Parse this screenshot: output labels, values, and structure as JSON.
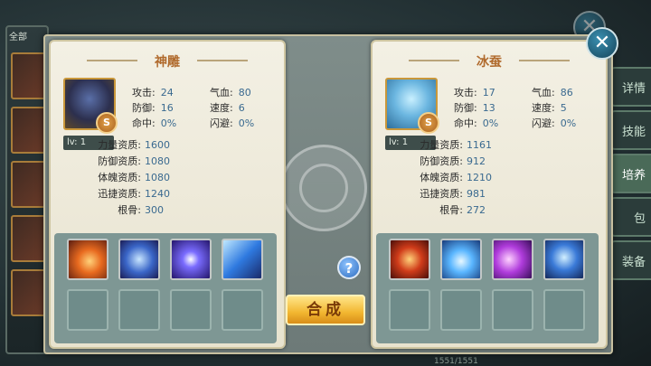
{
  "background": {
    "left_tab_label": "全部",
    "right_tabs": [
      "详情",
      "技能",
      "培养",
      "包",
      "装备"
    ],
    "footer_text": "1551/1551"
  },
  "left_pet": {
    "name": "神雕",
    "icon": "eagle-portrait",
    "rank_badge": "S",
    "level": "lv: 1",
    "stats": [
      {
        "label": "攻击:",
        "value": "24"
      },
      {
        "label": "气血:",
        "value": "80"
      },
      {
        "label": "防御:",
        "value": "16"
      },
      {
        "label": "速度:",
        "value": "6"
      },
      {
        "label": "命中:",
        "value": "0%"
      },
      {
        "label": "闪避:",
        "value": "0%"
      }
    ],
    "aptitudes": [
      {
        "label": "力量资质:",
        "value": "1600"
      },
      {
        "label": "防御资质:",
        "value": "1080"
      },
      {
        "label": "体魄资质:",
        "value": "1080"
      },
      {
        "label": "迅捷资质:",
        "value": "1240"
      },
      {
        "label": "根骨:",
        "value": "300"
      }
    ],
    "skills": [
      "fire-phoenix-skill-icon",
      "claw-slash-skill-icon",
      "thunder-orb-skill-icon",
      "lightning-z-skill-icon"
    ]
  },
  "right_pet": {
    "name": "冰蚕",
    "icon": "ice-silkworm-portrait",
    "rank_badge": "S",
    "level": "lv: 1",
    "stats": [
      {
        "label": "攻击:",
        "value": "17"
      },
      {
        "label": "气血:",
        "value": "86"
      },
      {
        "label": "防御:",
        "value": "13"
      },
      {
        "label": "速度:",
        "value": "5"
      },
      {
        "label": "命中:",
        "value": "0%"
      },
      {
        "label": "闪避:",
        "value": "0%"
      }
    ],
    "aptitudes": [
      {
        "label": "力量资质:",
        "value": "1161"
      },
      {
        "label": "防御资质:",
        "value": "912"
      },
      {
        "label": "体魄资质:",
        "value": "1210"
      },
      {
        "label": "迅捷资质:",
        "value": "981"
      },
      {
        "label": "根骨:",
        "value": "272"
      }
    ],
    "skills": [
      "fire-ring-skill-icon",
      "water-splash-skill-icon",
      "arcane-beam-skill-icon",
      "shield-skill-icon"
    ]
  },
  "buttons": {
    "help": "?",
    "combine": "合成",
    "close": "✕"
  }
}
